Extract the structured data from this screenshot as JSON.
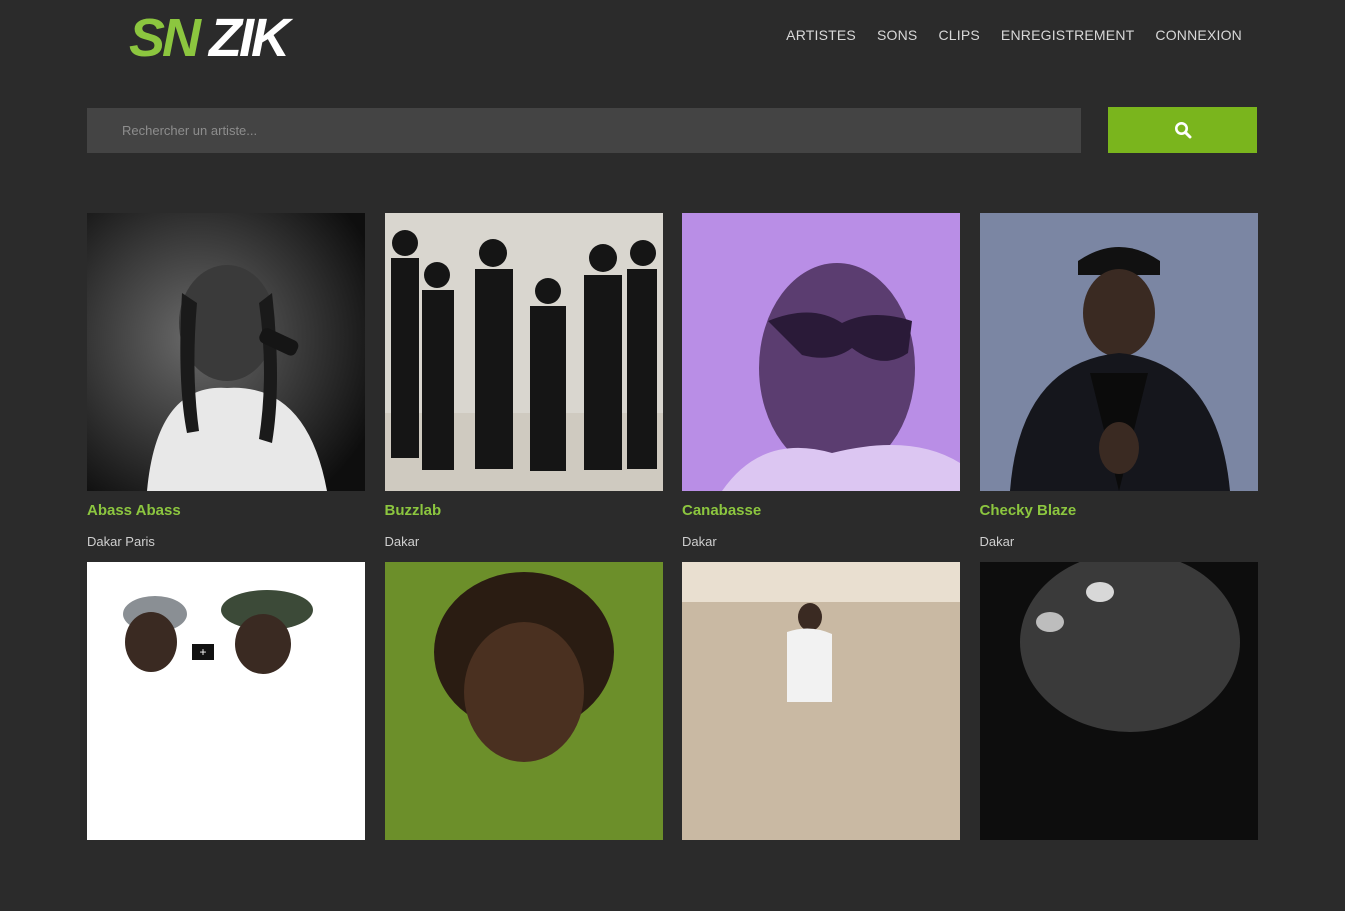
{
  "brand": {
    "logo_text_part1": "SN",
    "logo_text_part2": "ZIK",
    "accent": "#7ab51d"
  },
  "nav": {
    "items": [
      {
        "label": "ARTISTES"
      },
      {
        "label": "SONS"
      },
      {
        "label": "CLIPS"
      },
      {
        "label": "ENREGISTREMENT"
      },
      {
        "label": "CONNEXION"
      }
    ]
  },
  "search": {
    "placeholder": "Rechercher un artiste...",
    "value": "",
    "button_icon": "search-icon"
  },
  "artists": [
    {
      "name": "Abass Abass",
      "city": "Dakar Paris"
    },
    {
      "name": "Buzzlab",
      "city": "Dakar"
    },
    {
      "name": "Canabasse",
      "city": "Dakar"
    },
    {
      "name": "Checky Blaze",
      "city": "Dakar"
    },
    {
      "name": "",
      "city": "",
      "badge": "+"
    },
    {
      "name": "",
      "city": ""
    },
    {
      "name": "",
      "city": ""
    },
    {
      "name": "",
      "city": ""
    }
  ]
}
